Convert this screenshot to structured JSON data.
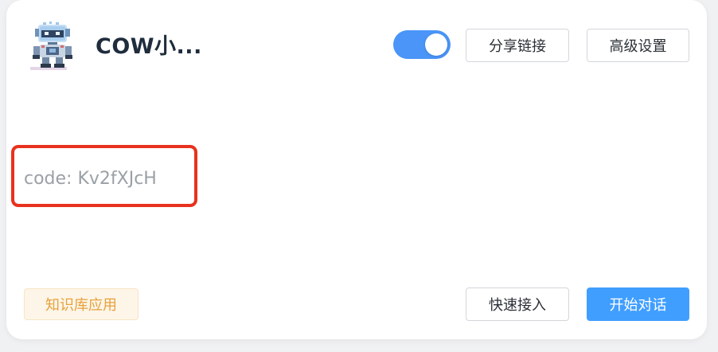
{
  "app": {
    "name": "COW小...",
    "avatar_icon": "pixel-robot-avatar"
  },
  "header": {
    "toggle_state": "on",
    "share_label": "分享链接",
    "advanced_label": "高级设置"
  },
  "body": {
    "code_text": "code: Kv2fXJcH"
  },
  "footer": {
    "badge_label": "知识库应用",
    "quick_access_label": "快速接入",
    "start_chat_label": "开始对话"
  },
  "colors": {
    "accent": "#409eff",
    "toggle_on": "#4a95f7",
    "highlight_border": "#e8321e",
    "badge_text": "#e6a23c",
    "badge_bg": "#fdf5e8"
  }
}
